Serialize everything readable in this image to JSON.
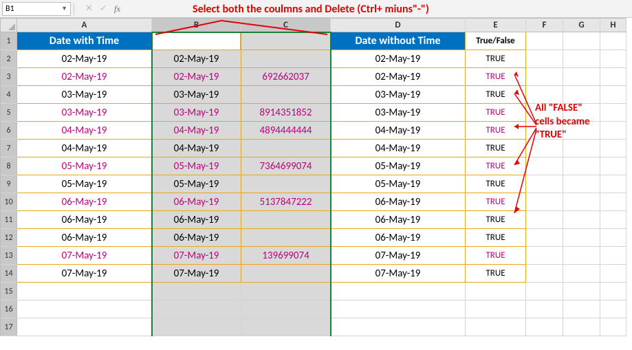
{
  "name_box": "B1",
  "formula": "",
  "annotations": {
    "top": "Select both the coulmns and Delete (Ctrl+ miuns\"-\")",
    "side1": "All \"FALSE\"",
    "side2": "cells became",
    "side3": "\"TRUE\""
  },
  "col_heads": {
    "A": "A",
    "B": "B",
    "C": "C",
    "D": "D",
    "E": "E",
    "F": "F",
    "G": "G",
    "H": "H"
  },
  "header": {
    "A": "Date with Time",
    "B": "",
    "C": "",
    "D": "Date without Time",
    "E": "True/False"
  },
  "rows": [
    {
      "n": "2",
      "a": "02-May-19",
      "b": "02-May-19",
      "c": "",
      "d": "02-May-19",
      "e": "TRUE",
      "mag": false
    },
    {
      "n": "3",
      "a": "02-May-19",
      "b": "02-May-19",
      "c": "692662037",
      "d": "02-May-19",
      "e": "TRUE",
      "mag": true
    },
    {
      "n": "4",
      "a": "03-May-19",
      "b": "03-May-19",
      "c": "",
      "d": "03-May-19",
      "e": "TRUE",
      "mag": false
    },
    {
      "n": "5",
      "a": "03-May-19",
      "b": "03-May-19",
      "c": "8914351852",
      "d": "03-May-19",
      "e": "TRUE",
      "mag": true
    },
    {
      "n": "6",
      "a": "04-May-19",
      "b": "04-May-19",
      "c": "4894444444",
      "d": "04-May-19",
      "e": "TRUE",
      "mag": true
    },
    {
      "n": "7",
      "a": "04-May-19",
      "b": "04-May-19",
      "c": "",
      "d": "04-May-19",
      "e": "TRUE",
      "mag": false
    },
    {
      "n": "8",
      "a": "05-May-19",
      "b": "05-May-19",
      "c": "7364699074",
      "d": "05-May-19",
      "e": "TRUE",
      "mag": true
    },
    {
      "n": "9",
      "a": "05-May-19",
      "b": "05-May-19",
      "c": "",
      "d": "05-May-19",
      "e": "TRUE",
      "mag": false
    },
    {
      "n": "10",
      "a": "06-May-19",
      "b": "06-May-19",
      "c": "5137847222",
      "d": "06-May-19",
      "e": "TRUE",
      "mag": true
    },
    {
      "n": "11",
      "a": "06-May-19",
      "b": "06-May-19",
      "c": "",
      "d": "06-May-19",
      "e": "TRUE",
      "mag": false
    },
    {
      "n": "12",
      "a": "06-May-19",
      "b": "06-May-19",
      "c": "",
      "d": "06-May-19",
      "e": "TRUE",
      "mag": false
    },
    {
      "n": "13",
      "a": "07-May-19",
      "b": "07-May-19",
      "c": "139699074",
      "d": "07-May-19",
      "e": "TRUE",
      "mag": true
    },
    {
      "n": "14",
      "a": "07-May-19",
      "b": "07-May-19",
      "c": "",
      "d": "07-May-19",
      "e": "TRUE",
      "mag": false
    }
  ],
  "empty_rows": [
    "15",
    "16",
    "17"
  ]
}
